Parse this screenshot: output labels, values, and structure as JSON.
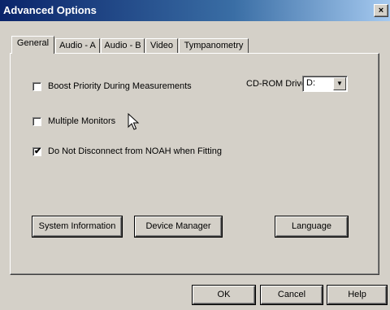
{
  "window": {
    "title": "Advanced Options",
    "close_label": "×"
  },
  "tabs": [
    {
      "label": "General",
      "active": true
    },
    {
      "label": "Audio - A",
      "active": false
    },
    {
      "label": "Audio - B",
      "active": false
    },
    {
      "label": "Video",
      "active": false
    },
    {
      "label": "Tympanometry",
      "active": false
    }
  ],
  "options": {
    "boost_priority": {
      "label": "Boost Priority During Measurements",
      "checked": false
    },
    "multiple_monitors": {
      "label": "Multiple Monitors",
      "checked": false
    },
    "do_not_disconnect": {
      "label": "Do Not Disconnect from NOAH when Fitting",
      "checked": true
    }
  },
  "cdrom": {
    "label": "CD-ROM Drive:",
    "value": "D:"
  },
  "panel_buttons": {
    "system_information": "System Information",
    "device_manager": "Device Manager",
    "language": "Language"
  },
  "dialog_buttons": {
    "ok": "OK",
    "cancel": "Cancel",
    "help": "Help"
  },
  "icons": {
    "check_mark": "✔",
    "dropdown_arrow": "▼"
  }
}
